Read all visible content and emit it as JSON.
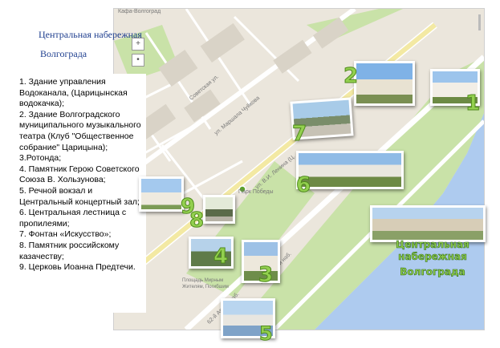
{
  "title": {
    "line1": "Центральная набережная",
    "line2": "Волгограда"
  },
  "legend": {
    "items": [
      "1. Здание управления Водоканала, (Царицынская водокачка);",
      "2. Здание Волгоградского муниципального музыкального театра (Клуб \"Общественное собрание\" Царицына);",
      "3.Ротонда;",
      "4. Памятник Герою  Советского Союза В. Хользунова;",
      "5. Речной вокзал и Центральный концертный зал;",
      "6. Центральная лестница с пропилеями;",
      "7. Фонтан «Искусство»;",
      "8. Памятник российскому казачеству;",
      "9. Церковь Иоанна Предтечи."
    ]
  },
  "map_labels": {
    "street1": "Советская ул.",
    "street2": "ул. Маршала Чуйкова",
    "street3": "ул. В.И. Ленина (Ц.",
    "street4": "62-й Армии наб.",
    "street5": "62-й Армии наб.",
    "park": "Парк Победы",
    "square": "Площадь Мирным Жителям, Погибшим",
    "top_street": "Кафа-Волгоград",
    "street6": "Чуйкова",
    "street7": "ул. Чуйкова"
  },
  "markers": [
    "1",
    "2",
    "3",
    "4",
    "5",
    "6",
    "7",
    "8",
    "9"
  ],
  "caption": {
    "line1": "Центральная набережная",
    "line2": "Волгограда"
  },
  "colors": {
    "park": "#c6e0a9",
    "river": "#a9c8f0",
    "road": "#ffffff",
    "marker": "#93d04f",
    "title": "#1f3f8f"
  }
}
